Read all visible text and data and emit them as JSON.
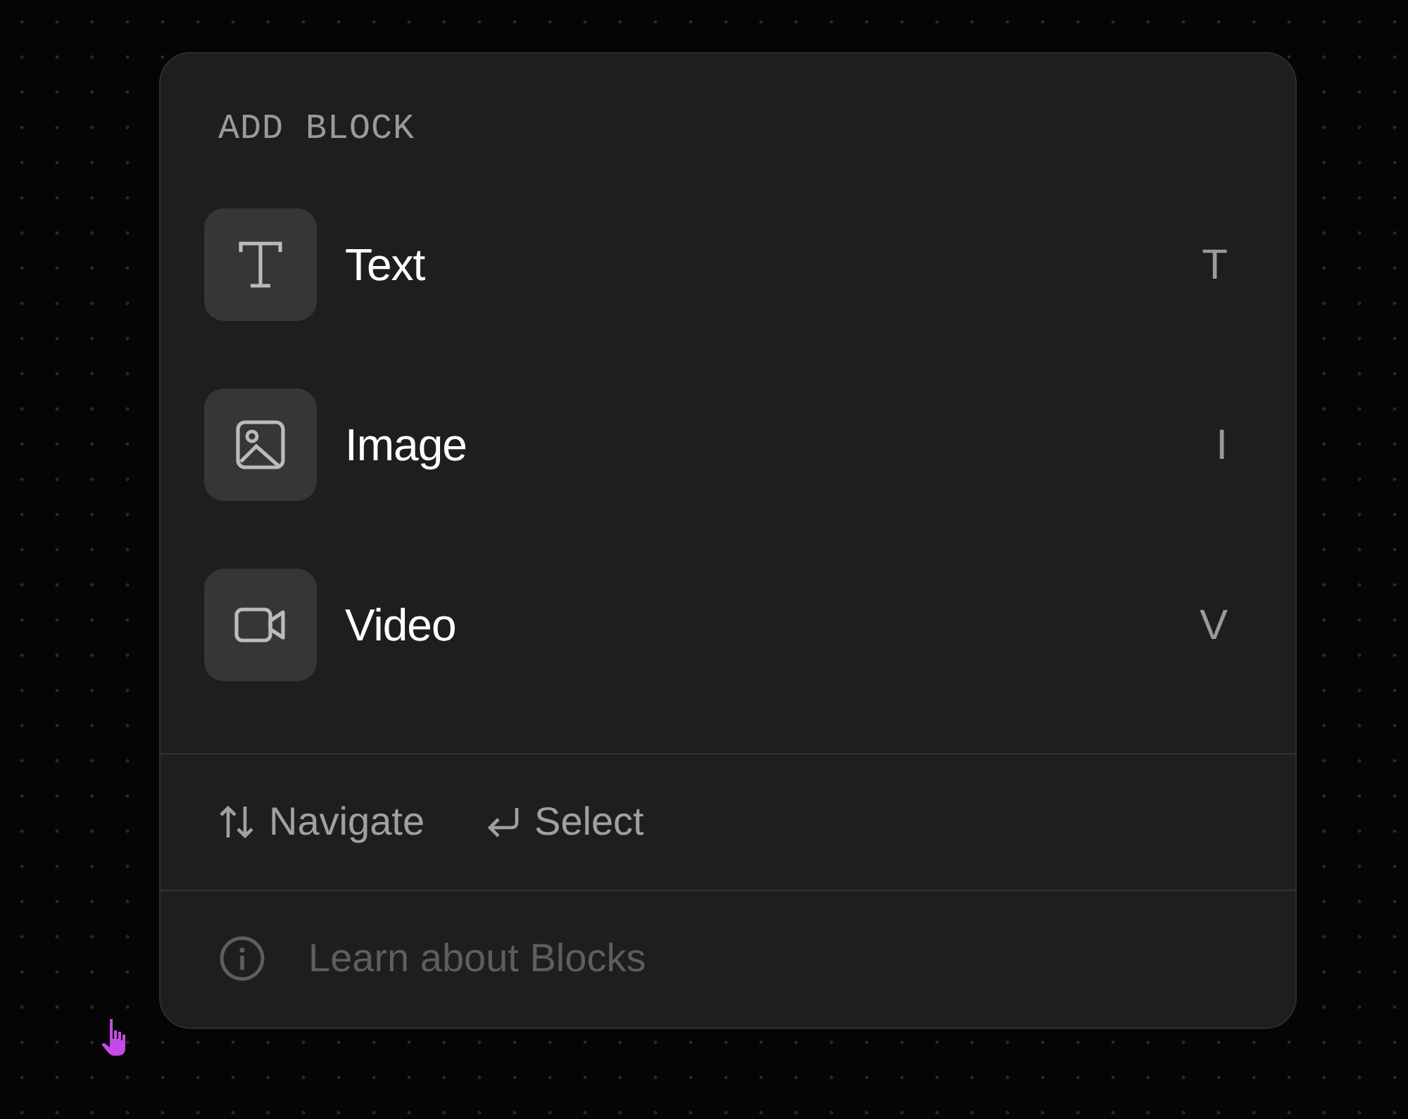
{
  "menu": {
    "title": "ADD BLOCK",
    "blocks": [
      {
        "kind": "text",
        "label": "Text",
        "shortcut": "T"
      },
      {
        "kind": "image",
        "label": "Image",
        "shortcut": "I"
      },
      {
        "kind": "video",
        "label": "Video",
        "shortcut": "V"
      }
    ],
    "hints": [
      {
        "kind": "updown",
        "label": "Navigate"
      },
      {
        "kind": "enter",
        "label": "Select"
      }
    ],
    "help": {
      "label": "Learn about Blocks"
    }
  }
}
